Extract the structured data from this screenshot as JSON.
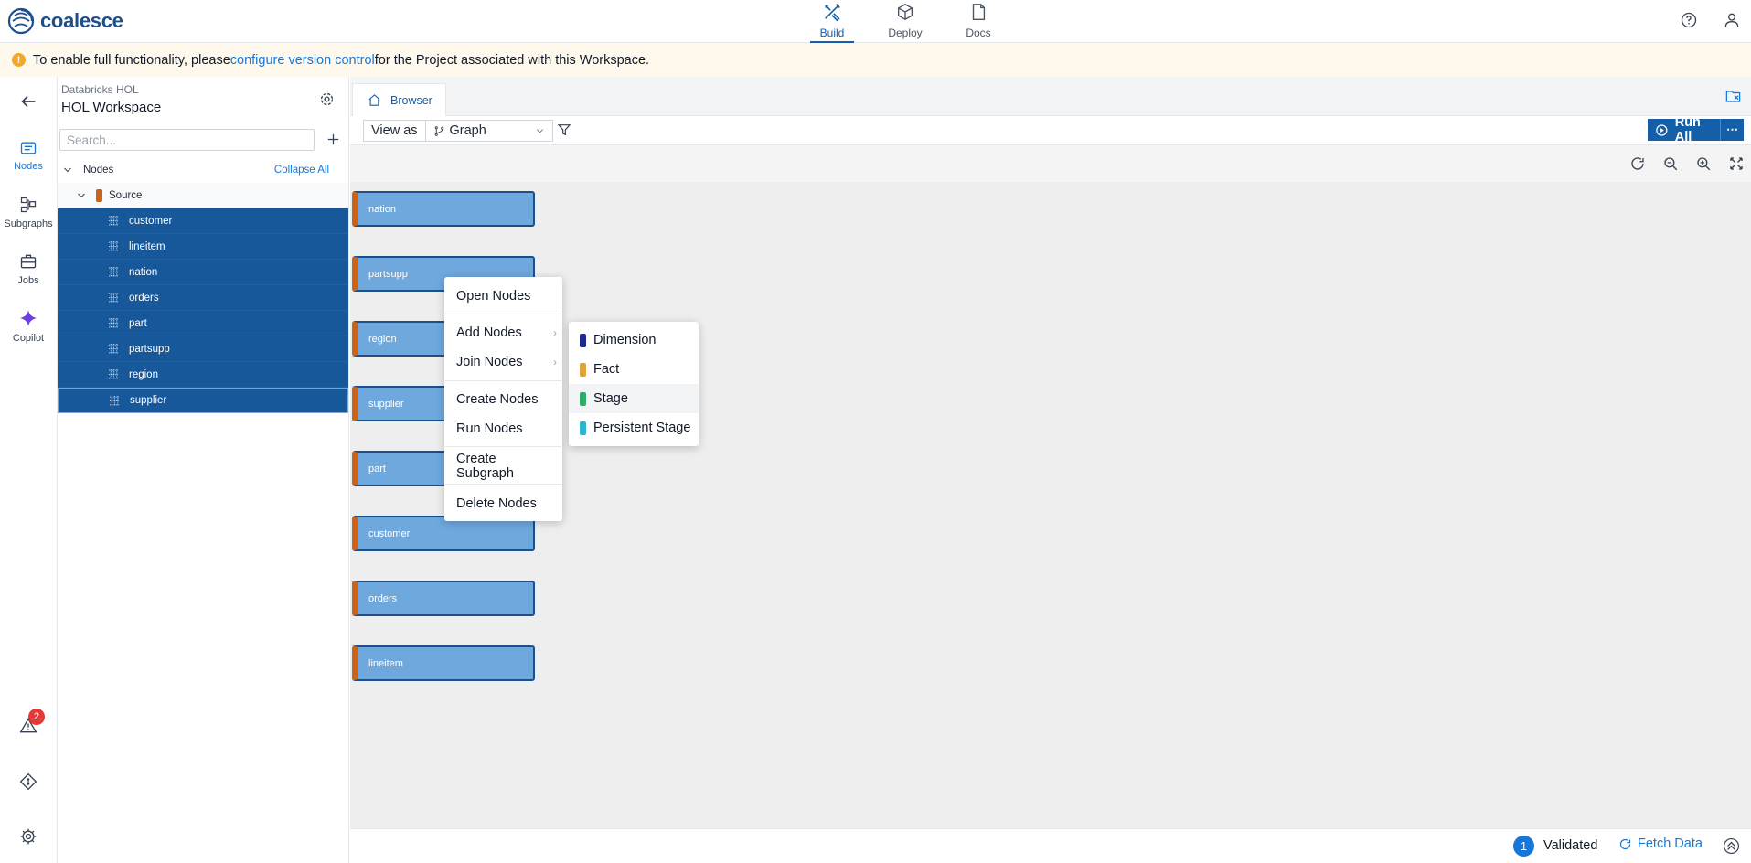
{
  "app": {
    "logo_text": "coalesce"
  },
  "topnav": [
    {
      "label": "Build",
      "icon": "tools-icon"
    },
    {
      "label": "Deploy",
      "icon": "cube-icon"
    },
    {
      "label": "Docs",
      "icon": "document-icon"
    }
  ],
  "banner": {
    "before": "To enable full functionality, please ",
    "link": "configure version control",
    "after": " for the Project associated with this Workspace."
  },
  "rail": {
    "items": [
      {
        "label": "Nodes"
      },
      {
        "label": "Subgraphs"
      },
      {
        "label": "Jobs"
      },
      {
        "label": "Copilot"
      }
    ],
    "alerts_count": "2"
  },
  "workspace": {
    "project": "Databricks HOL",
    "name": "HOL Workspace",
    "search_placeholder": "Search..."
  },
  "tree": {
    "root_label": "Nodes",
    "collapse_all": "Collapse All",
    "group_label": "Source",
    "nodes": [
      "customer",
      "lineitem",
      "nation",
      "orders",
      "part",
      "partsupp",
      "region",
      "supplier"
    ]
  },
  "tabs": {
    "browser": "Browser"
  },
  "toolbar": {
    "view_as": "View as",
    "view_mode": "Graph",
    "run_all": "Run All"
  },
  "graph": {
    "nodes": [
      "nation",
      "partsupp",
      "region",
      "supplier",
      "part",
      "customer",
      "orders",
      "lineitem"
    ]
  },
  "context_menu": {
    "open_nodes": "Open Nodes",
    "add_nodes": "Add Nodes",
    "join_nodes": "Join Nodes",
    "create_nodes": "Create Nodes",
    "run_nodes": "Run Nodes",
    "create_subgraph": "Create Subgraph",
    "delete_nodes": "Delete Nodes"
  },
  "submenu": [
    {
      "label": "Dimension",
      "color": "#1f2a8c"
    },
    {
      "label": "Fact",
      "color": "#e2a33a"
    },
    {
      "label": "Stage",
      "color": "#2fae6b"
    },
    {
      "label": "Persistent Stage",
      "color": "#2bb6d8"
    }
  ],
  "status": {
    "count": "1",
    "validated": "Validated",
    "fetch_data": "Fetch Data"
  },
  "colors": {
    "brand": "#1c4f8c",
    "accent": "#1677d9",
    "selected_row": "#17589a",
    "graph_node": "#6fa8dc",
    "source_stripe": "#c8641c"
  }
}
